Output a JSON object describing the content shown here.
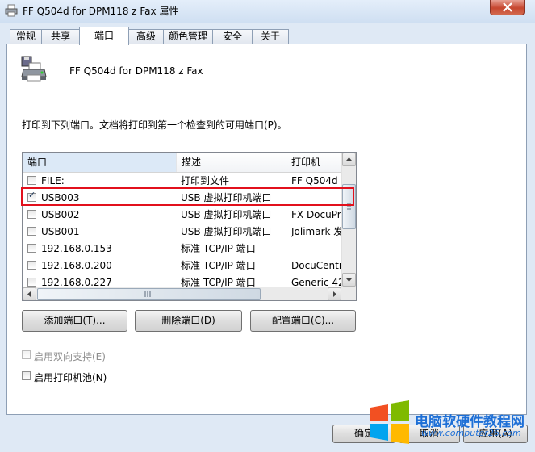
{
  "window": {
    "title": "FF Q504d for DPM118 z Fax 属性"
  },
  "tabs": [
    {
      "label": "常规"
    },
    {
      "label": "共享"
    },
    {
      "label": "端口",
      "active": true
    },
    {
      "label": "高级"
    },
    {
      "label": "颜色管理"
    },
    {
      "label": "安全"
    },
    {
      "label": "关于"
    }
  ],
  "printer": {
    "name": "FF Q504d for DPM118 z Fax",
    "icon": "printer-icon"
  },
  "instruction": "打印到下列端口。文档将打印到第一个检查到的可用端口(P)。",
  "ports": {
    "columns": [
      "端口",
      "描述",
      "打印机"
    ],
    "rows": [
      {
        "checked": false,
        "port": "FILE:",
        "desc": "打印到文件",
        "printer": "FF Q504d f"
      },
      {
        "checked": true,
        "port": "USB003",
        "desc": "USB 虚拟打印机端口",
        "printer": ""
      },
      {
        "checked": false,
        "port": "USB002",
        "desc": "USB 虚拟打印机端口",
        "printer": "FX DocuPri"
      },
      {
        "checked": false,
        "port": "USB001",
        "desc": "USB 虚拟打印机端口",
        "printer": "Jolimark 发"
      },
      {
        "checked": false,
        "port": "192.168.0.153",
        "desc": "标准 TCP/IP 端口",
        "printer": ""
      },
      {
        "checked": false,
        "port": "192.168.0.200",
        "desc": "标准 TCP/IP 端口",
        "printer": "DocuCentr"
      },
      {
        "checked": false,
        "port": "192.168.0.227",
        "desc": "标准 TCP/IP 端口",
        "printer": "Generic 42"
      }
    ]
  },
  "buttons": {
    "add_port": "添加端口(T)...",
    "delete_port": "删除端口(D)",
    "config_port": "配置端口(C)..."
  },
  "options": {
    "bidirectional": {
      "label": "启用双向支持(E)",
      "checked": false,
      "disabled": true
    },
    "pooling": {
      "label": "启用打印机池(N)",
      "checked": false,
      "disabled": false
    }
  },
  "footer": {
    "ok": "确定",
    "cancel": "取消",
    "apply": "应用(A)"
  },
  "watermark": {
    "text": "电脑软硬件教程网",
    "url": "www.computer26.com"
  },
  "colors": {
    "highlight": "#e2101c",
    "selected_header": "#dce9f7"
  }
}
